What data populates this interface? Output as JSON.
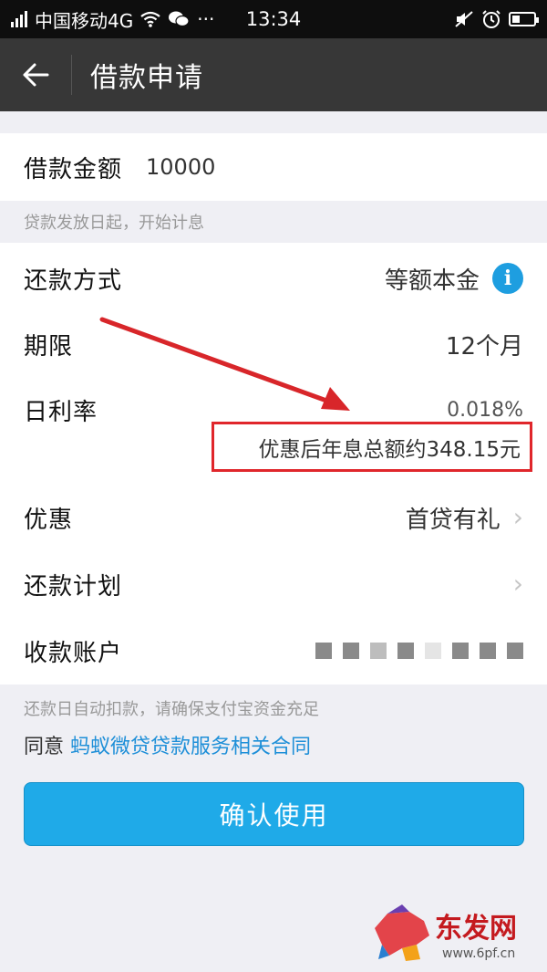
{
  "status_bar": {
    "carrier": "中国移动4G",
    "time": "13:34",
    "more": "···"
  },
  "header": {
    "title": "借款申请"
  },
  "loan": {
    "amount_label": "借款金额",
    "amount_value": "10000",
    "note": "贷款发放日起，开始计息"
  },
  "details": {
    "repay_method_label": "还款方式",
    "repay_method_value": "等额本金",
    "term_label": "期限",
    "term_value": "12个月",
    "rate_label": "日利率",
    "rate_value": "0.018%",
    "interest_summary": "优惠后年息总额约348.15元",
    "discount_label": "优惠",
    "discount_value": "首贷有礼",
    "plan_label": "还款计划",
    "account_label": "收款账户"
  },
  "footer": {
    "auto_debit_note": "还款日自动扣款，请确保支付宝资金充足",
    "agree_prefix": "同意 ",
    "agreement_link": "蚂蚁微贷贷款服务相关合同",
    "confirm_label": "确认使用"
  },
  "watermark": {
    "site_name": "东发网",
    "url": "www.6pf.cn"
  },
  "colors": {
    "titlebar": "#373737",
    "accent_blue": "#1faae8",
    "link_blue": "#1e8fd8",
    "highlight_red": "#e0262b"
  }
}
